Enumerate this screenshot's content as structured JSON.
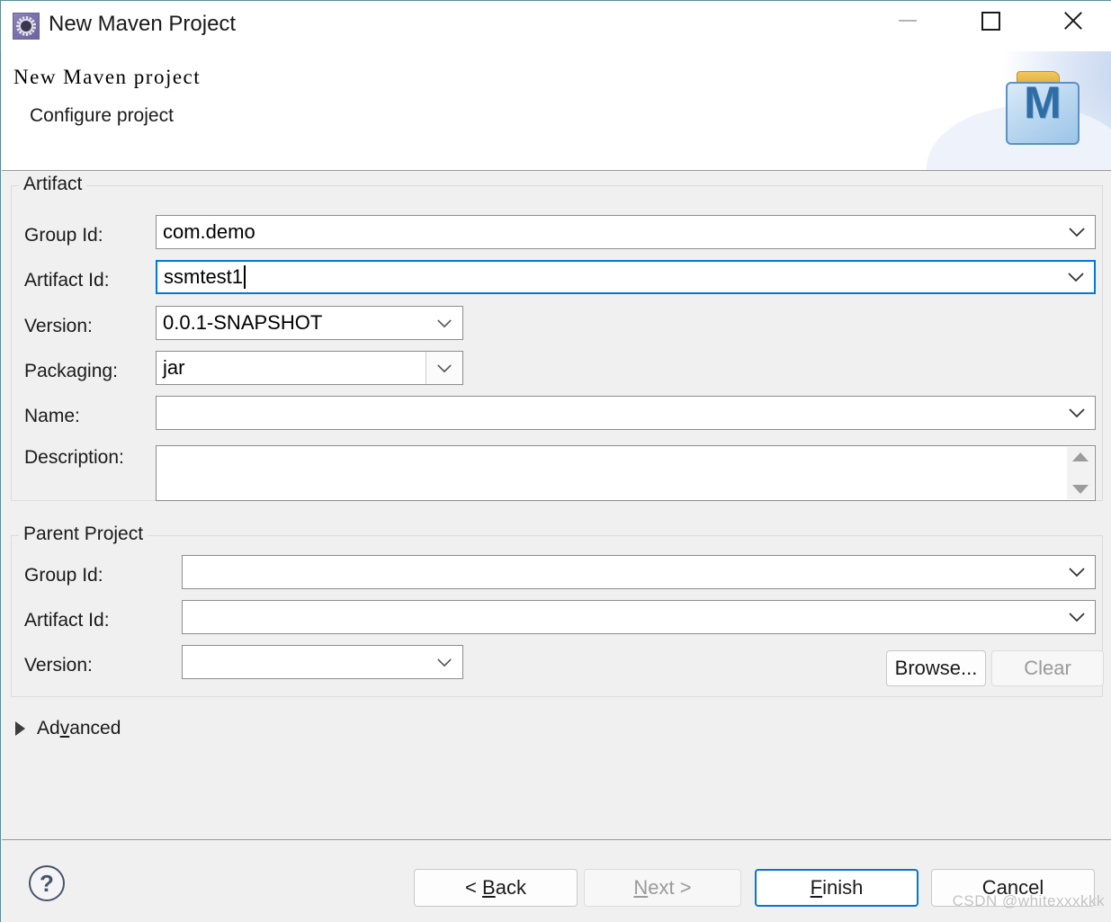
{
  "window": {
    "title": "New Maven Project",
    "icon": "maven-gear-icon",
    "controls": {
      "minimize": "minimize-icon",
      "maximize": "maximize-icon",
      "close": "close-icon"
    }
  },
  "header": {
    "title": "New Maven project",
    "subtitle": "Configure project",
    "banner_icon": "maven-folder-icon",
    "banner_letter": "M"
  },
  "artifact": {
    "legend": "Artifact",
    "fields": {
      "group_id": {
        "label": "Group Id:",
        "value": "com.demo",
        "placeholder": ""
      },
      "artifact_id": {
        "label": "Artifact Id:",
        "value": "ssmtest1",
        "placeholder": "",
        "focused": true
      },
      "version": {
        "label": "Version:",
        "value": "0.0.1-SNAPSHOT",
        "placeholder": ""
      },
      "packaging": {
        "label": "Packaging:",
        "value": "jar",
        "placeholder": ""
      },
      "name": {
        "label": "Name:",
        "value": "",
        "placeholder": ""
      },
      "description": {
        "label": "Description:",
        "value": "",
        "placeholder": ""
      }
    }
  },
  "parent_project": {
    "legend": "Parent Project",
    "fields": {
      "group_id": {
        "label": "Group Id:",
        "value": "",
        "placeholder": ""
      },
      "artifact_id": {
        "label": "Artifact Id:",
        "value": "",
        "placeholder": ""
      },
      "version": {
        "label": "Version:",
        "value": "",
        "placeholder": ""
      }
    },
    "browse_label": "Browse...",
    "clear_label": "Clear",
    "clear_enabled": false
  },
  "advanced": {
    "label": "Advanced",
    "expanded": false
  },
  "footer": {
    "help_label": "?",
    "buttons": {
      "back": {
        "label": "< Back",
        "enabled": true
      },
      "next": {
        "label": "Next >",
        "enabled": false
      },
      "finish": {
        "label": "Finish",
        "enabled": true,
        "default": true
      },
      "cancel": {
        "label": "Cancel",
        "enabled": true
      }
    }
  },
  "watermark": "CSDN @whitexxxkkk",
  "colors": {
    "focus_border": "#0078d4",
    "dialog_bg": "#f0f0f0",
    "field_bg": "#ffffff",
    "disabled_text": "#9a9a9a",
    "help_icon": "#46536b"
  }
}
